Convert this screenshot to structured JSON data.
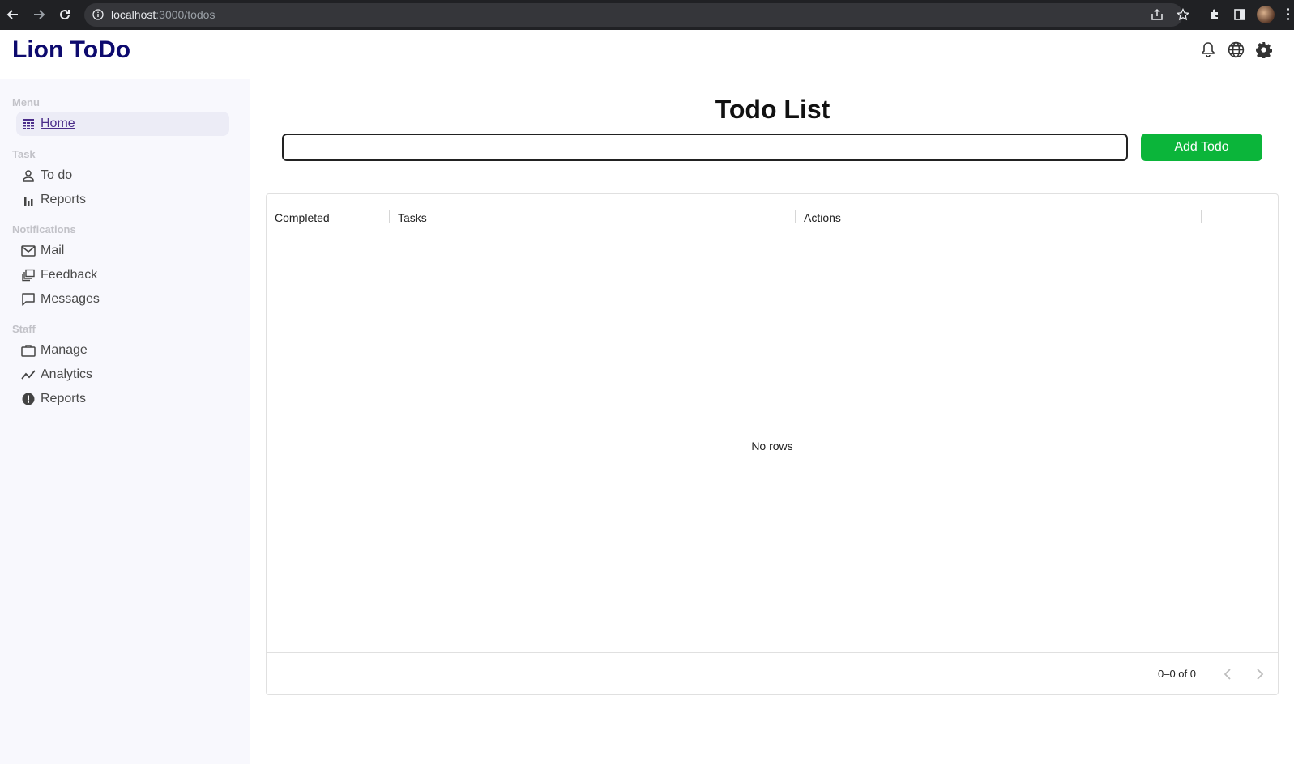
{
  "browser": {
    "url_host": "localhost",
    "url_rest": ":3000/todos"
  },
  "header": {
    "brand": "Lion ToDo"
  },
  "sidebar": {
    "sections": [
      {
        "label": "Menu"
      },
      {
        "label": "Task"
      },
      {
        "label": "Notifications"
      },
      {
        "label": "Staff"
      }
    ],
    "items": [
      {
        "label": "Home",
        "icon": "table-icon",
        "active": true
      },
      {
        "label": "To do",
        "icon": "person-icon"
      },
      {
        "label": "Reports",
        "icon": "bar-chart-icon"
      },
      {
        "label": "Mail",
        "icon": "mail-icon"
      },
      {
        "label": "Feedback",
        "icon": "feedback-icon"
      },
      {
        "label": "Messages",
        "icon": "chat-icon"
      },
      {
        "label": "Manage",
        "icon": "briefcase-icon"
      },
      {
        "label": "Analytics",
        "icon": "trending-icon"
      },
      {
        "label": "Reports",
        "icon": "report-icon"
      }
    ]
  },
  "main": {
    "title": "Todo List",
    "input": {
      "value": "",
      "placeholder": ""
    },
    "add_button": "Add Todo",
    "table": {
      "columns": [
        "Completed",
        "Tasks",
        "Actions"
      ],
      "empty_text": "No rows",
      "pagination": "0–0 of 0"
    }
  },
  "colors": {
    "brand": "#0d0a6e",
    "add_button": "#0bb53a",
    "active_nav": "#4b2d8a"
  }
}
